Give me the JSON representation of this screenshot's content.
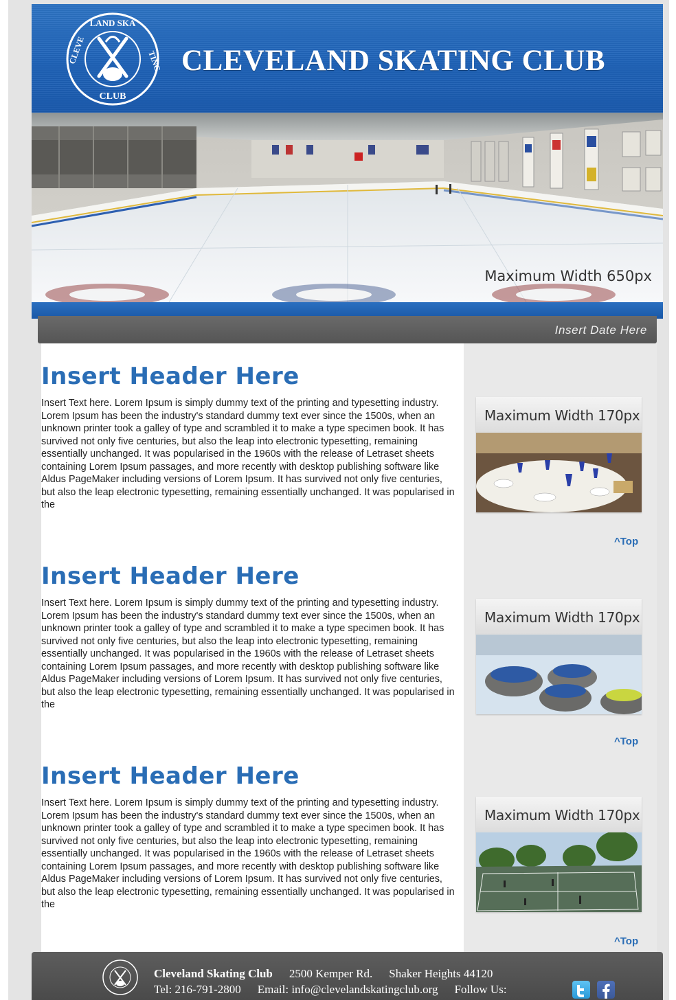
{
  "header": {
    "title": "CLEVELAND SKATING CLUB",
    "logo_text": "CLEVELAND SKATING CLUB"
  },
  "hero": {
    "caption": "Maximum Width 650px"
  },
  "date_bar": {
    "text": "Insert Date Here"
  },
  "sections": [
    {
      "header": "Insert Header Here",
      "body": "Insert Text here. Lorem Ipsum is simply dummy text of the printing and typesetting industry. Lorem Ipsum has been the industry's standard dummy text ever since the 1500s, when an unknown printer took a galley of type and scrambled it to make a type specimen book. It has survived not only five centuries, but also the leap into electronic typesetting, remaining essentially unchanged. It was popularised in the 1960s with the release of Letraset sheets containing Lorem Ipsum passages, and more recently with desktop publishing software like Aldus PageMaker including versions of Lorem Ipsum. It has survived not only five centuries, but also the leap electronic typesetting, remaining essentially unchanged. It was popularised in the",
      "image_caption": "Maximum Width 170px",
      "top_link": "^Top"
    },
    {
      "header": "Insert Header Here",
      "body": "Insert Text here. Lorem Ipsum is simply dummy text of the printing and typesetting industry. Lorem Ipsum has been the industry's standard dummy text ever since the 1500s, when an unknown printer took a galley of type and scrambled it to make a type specimen book. It has survived not only five centuries, but also the leap into electronic typesetting, remaining essentially unchanged. It was popularised in the 1960s with the release of Letraset sheets containing Lorem Ipsum passages, and more recently with desktop publishing software like Aldus PageMaker including versions of Lorem Ipsum. It has survived not only five centuries, but also the leap electronic typesetting, remaining essentially unchanged. It was popularised in the",
      "image_caption": "Maximum Width 170px",
      "top_link": "^Top"
    },
    {
      "header": "Insert Header Here",
      "body": "Insert Text here. Lorem Ipsum is simply dummy text of the printing and typesetting industry. Lorem Ipsum has been the industry's standard dummy text ever since the 1500s, when an unknown printer took a galley of type and scrambled it to make a type specimen book. It has survived not only five centuries, but also the leap into electronic typesetting, remaining essentially unchanged. It was popularised in the 1960s with the release of Letraset sheets containing Lorem Ipsum passages, and more recently with desktop publishing software like Aldus PageMaker including versions of Lorem Ipsum. It has survived not only five centuries, but also the leap electronic typesetting, remaining essentially unchanged. It was popularised in the",
      "image_caption": "Maximum Width 170px",
      "top_link": "^Top"
    }
  ],
  "footer": {
    "name": "Cleveland Skating Club",
    "address": "2500 Kemper Rd.",
    "city": "Shaker Heights 44120",
    "phone": "Tel: 216-791-2800",
    "email": "Email: info@clevelandskatingclub.org",
    "follow": "Follow Us:"
  },
  "colors": {
    "brand_blue": "#1f63b8",
    "header_text_blue": "#2a6db5",
    "footer_gray": "#555555"
  },
  "icons": [
    "club-logo-icon",
    "twitter-icon",
    "facebook-icon"
  ]
}
